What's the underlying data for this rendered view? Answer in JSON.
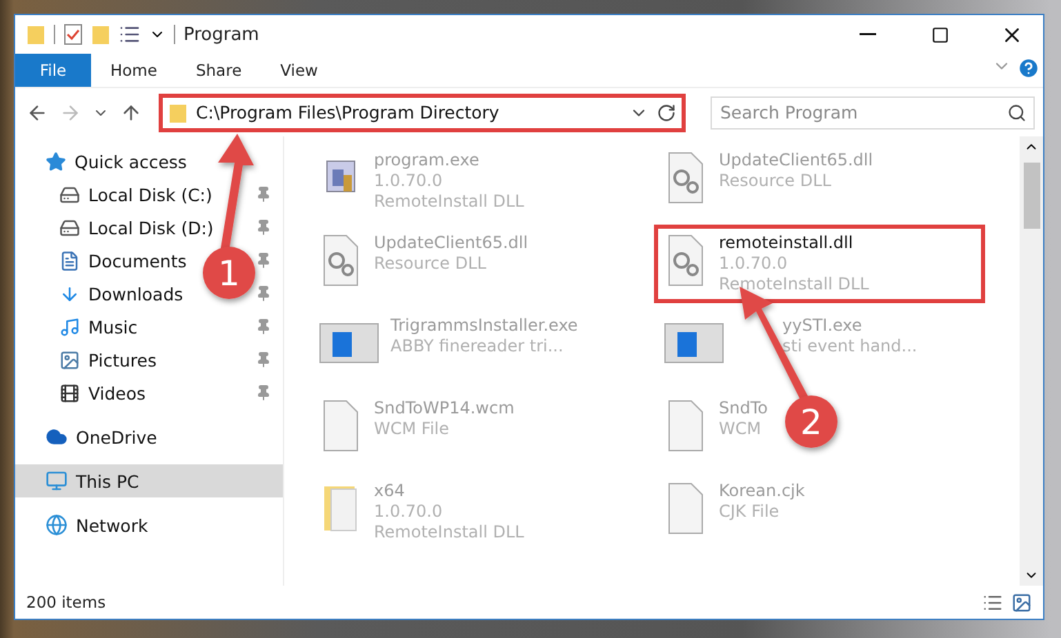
{
  "window": {
    "title": "Program"
  },
  "ribbon": {
    "tabs": [
      {
        "label": "File",
        "selected": true
      },
      {
        "label": "Home",
        "selected": false
      },
      {
        "label": "Share",
        "selected": false
      },
      {
        "label": "View",
        "selected": false
      }
    ]
  },
  "address_bar": {
    "path": "C:\\Program Files\\Program Directory",
    "highlighted": true
  },
  "search": {
    "placeholder": "Search Program"
  },
  "sidebar": {
    "items": [
      {
        "label": "Quick access",
        "selected": false,
        "children": [
          {
            "label": "Local Disk (C:)",
            "pinned": true
          },
          {
            "label": "Local Disk (D:)",
            "pinned": true
          },
          {
            "label": "Documents",
            "pinned": true
          },
          {
            "label": "Downloads",
            "pinned": true
          },
          {
            "label": "Music",
            "pinned": true
          },
          {
            "label": "Pictures",
            "pinned": true
          },
          {
            "label": "Videos",
            "pinned": true
          }
        ]
      },
      {
        "label": "OneDrive",
        "selected": false
      },
      {
        "label": "This PC",
        "selected": true
      },
      {
        "label": "Network",
        "selected": false
      }
    ]
  },
  "files": [
    {
      "kind": "app",
      "name": "program.exe",
      "lines": [
        "1.0.70.0",
        "RemoteInstall DLL"
      ],
      "highlighted": false
    },
    {
      "kind": "gears",
      "name": "UpdateClient65.dll",
      "lines": [
        "Resource DLL"
      ],
      "highlighted": false
    },
    {
      "kind": "gears",
      "name": "UpdateClient65.dll",
      "lines": [
        "Resource DLL"
      ],
      "highlighted": false
    },
    {
      "kind": "gears",
      "name": "remoteinstall.dll",
      "lines": [
        "1.0.70.0",
        "RemoteInstall DLL"
      ],
      "highlighted": true
    },
    {
      "kind": "window",
      "name": "TrigrammsInstaller.exe",
      "lines": [
        "ABBY finereader tri..."
      ],
      "highlighted": false
    },
    {
      "kind": "window",
      "name": "yySTI.exe",
      "lines": [
        "sti event hand..."
      ],
      "highlighted": false
    },
    {
      "kind": "blank",
      "name": "SndToWP14.wcm",
      "lines": [
        "WCM File"
      ],
      "highlighted": false
    },
    {
      "kind": "blank",
      "name": "SndTo",
      "lines": [
        "WCM"
      ],
      "highlighted": false
    },
    {
      "kind": "folder",
      "name": "x64",
      "lines": [
        "1.0.70.0",
        "RemoteInstall DLL"
      ],
      "highlighted": false
    },
    {
      "kind": "blank",
      "name": "Korean.cjk",
      "lines": [
        "CJK File"
      ],
      "highlighted": false
    }
  ],
  "status_bar": {
    "count": "200 items"
  },
  "annotations": [
    {
      "number": "1"
    },
    {
      "number": "2"
    }
  ]
}
